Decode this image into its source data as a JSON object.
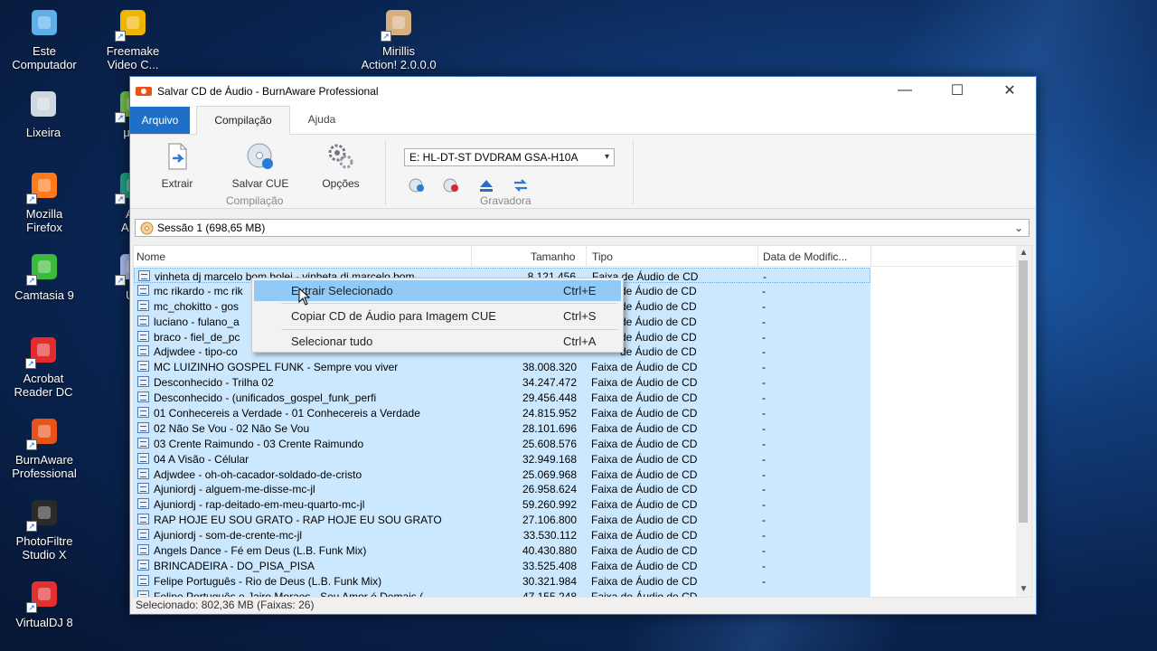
{
  "desktop": {
    "icons": [
      {
        "id": "computer",
        "label": "Este\nComputador"
      },
      {
        "id": "freemake",
        "label": "Freemake\nVideo C..."
      },
      {
        "id": "mirillis",
        "label": "Mirillis\nAction! 2.0.0.0"
      },
      {
        "id": "trash",
        "label": "Lixeira"
      },
      {
        "id": "utorrent",
        "label": "µTo"
      },
      {
        "id": "firefox",
        "label": "Mozilla\nFirefox"
      },
      {
        "id": "adobe-audition",
        "label": "Ad\nAudi"
      },
      {
        "id": "camtasia",
        "label": "Camtasia 9"
      },
      {
        "id": "ultra",
        "label": "Ult"
      },
      {
        "id": "acrobat",
        "label": "Acrobat\nReader DC"
      },
      {
        "id": "burnaware",
        "label": "BurnAware\nProfessional"
      },
      {
        "id": "photofiltre",
        "label": "PhotoFiltre\nStudio X"
      },
      {
        "id": "virtualdj",
        "label": "VirtualDJ 8"
      }
    ]
  },
  "window": {
    "title": "Salvar CD de Áudio - BurnAware Professional",
    "controls": {
      "minimize": "—",
      "maximize": "☐",
      "close": "✕"
    }
  },
  "tabs": {
    "file": "Arquivo",
    "compilation": "Compilação",
    "help": "Ajuda"
  },
  "ribbon": {
    "extract": "Extrair",
    "save_cue": "Salvar CUE",
    "options": "Opções",
    "group_compilation": "Compilação",
    "drive": "E: HL-DT-ST DVDRAM GSA-H10A",
    "group_recorder": "Gravadora"
  },
  "session": "Sessão 1 (698,65 MB)",
  "columns": {
    "name": "Nome",
    "size": "Tamanho",
    "type": "Tipo",
    "date": "Data de Modific..."
  },
  "tracks": [
    {
      "name": "vinheta dj marcelo bom bolei - vinheta di marcelo bom ...",
      "size": "8.121.456",
      "type": "Faixa de Áudio de CD",
      "date": "-"
    },
    {
      "name": "mc rikardo - mc rik",
      "size": "",
      "type": "de Áudio de CD",
      "date": "-"
    },
    {
      "name": "mc_chokitto - gos",
      "size": "",
      "type": "de Áudio de CD",
      "date": "-"
    },
    {
      "name": "luciano - fulano_a",
      "size": "",
      "type": "de Áudio de CD",
      "date": "-"
    },
    {
      "name": "braco - fiel_de_pc",
      "size": "",
      "type": "de Áudio de CD",
      "date": "-"
    },
    {
      "name": "Adjwdee - tipo-co",
      "size": "",
      "type": "de Áudio de CD",
      "date": "-"
    },
    {
      "name": "MC LUIZINHO GOSPEL FUNK - Sempre vou viver",
      "size": "38.008.320",
      "type": "Faixa de Áudio de CD",
      "date": "-"
    },
    {
      "name": "Desconhecido - Trilha 02",
      "size": "34.247.472",
      "type": "Faixa de Áudio de CD",
      "date": "-"
    },
    {
      "name": "Desconhecido - (unificados_gospel_funk_perfi",
      "size": "29.456.448",
      "type": "Faixa de Áudio de CD",
      "date": "-"
    },
    {
      "name": "01 Conhecereis a Verdade - 01 Conhecereis a Verdade",
      "size": "24.815.952",
      "type": "Faixa de Áudio de CD",
      "date": "-"
    },
    {
      "name": "02 Não Se Vou - 02 Não Se Vou",
      "size": "28.101.696",
      "type": "Faixa de Áudio de CD",
      "date": "-"
    },
    {
      "name": "03 Crente Raimundo - 03 Crente Raimundo",
      "size": "25.608.576",
      "type": "Faixa de Áudio de CD",
      "date": "-"
    },
    {
      "name": "04 A Visão - Célular",
      "size": "32.949.168",
      "type": "Faixa de Áudio de CD",
      "date": "-"
    },
    {
      "name": "Adjwdee - oh-oh-cacador-soldado-de-cristo",
      "size": "25.069.968",
      "type": "Faixa de Áudio de CD",
      "date": "-"
    },
    {
      "name": "Ajuniordj - alguem-me-disse-mc-jl",
      "size": "26.958.624",
      "type": "Faixa de Áudio de CD",
      "date": "-"
    },
    {
      "name": "Ajuniordj - rap-deitado-em-meu-quarto-mc-jl",
      "size": "59.260.992",
      "type": "Faixa de Áudio de CD",
      "date": "-"
    },
    {
      "name": "RAP HOJE EU SOU GRATO - RAP HOJE EU SOU GRATO",
      "size": "27.106.800",
      "type": "Faixa de Áudio de CD",
      "date": "-"
    },
    {
      "name": "Ajuniordj - som-de-crente-mc-jl",
      "size": "33.530.112",
      "type": "Faixa de Áudio de CD",
      "date": "-"
    },
    {
      "name": "Angels Dance - Fé em Deus (L.B. Funk Mix)",
      "size": "40.430.880",
      "type": "Faixa de Áudio de CD",
      "date": "-"
    },
    {
      "name": "BRINCADEIRA - DO_PISA_PISA",
      "size": "33.525.408",
      "type": "Faixa de Áudio de CD",
      "date": "-"
    },
    {
      "name": "Felipe Português - Rio de Deus (L.B. Funk Mix)",
      "size": "30.321.984",
      "type": "Faixa de Áudio de CD",
      "date": "-"
    },
    {
      "name": "Felipe Português e Jairo Moraes - Seu Amor é Demais (",
      "size": "47.155.248",
      "type": "Faixa de Áudio de CD",
      "date": "-"
    }
  ],
  "status": "Selecionado: 802,36 MB (Faixas: 26)",
  "context_menu": [
    {
      "label": "Extrair Selecionado",
      "shortcut": "Ctrl+E"
    },
    {
      "label": "Copiar CD de Áudio para Imagem CUE",
      "shortcut": "Ctrl+S"
    },
    {
      "label": "Selecionar tudo",
      "shortcut": "Ctrl+A"
    }
  ],
  "colors": {
    "accent": "#1e6fc8",
    "selection": "#cce8ff",
    "menu_highlight": "#91c9f7"
  }
}
